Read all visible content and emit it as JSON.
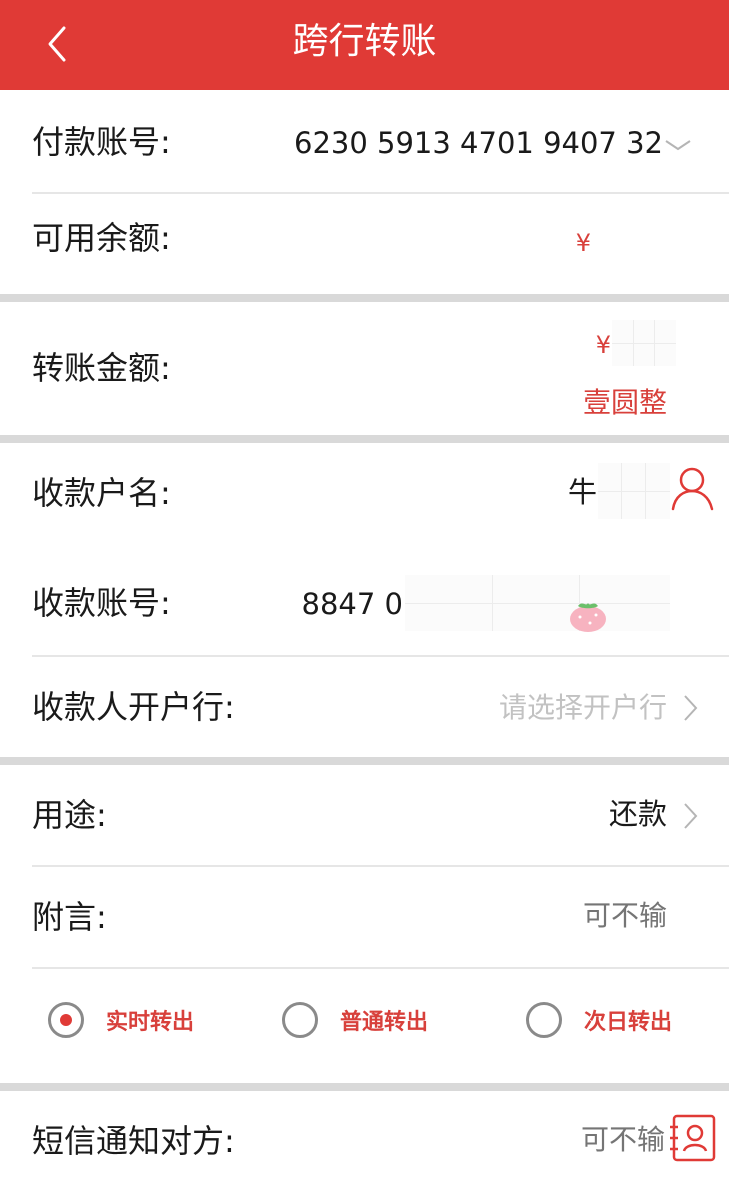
{
  "header": {
    "title": "跨行转账",
    "back_icon": "chevron-left-icon",
    "background": "#e03a36"
  },
  "payer": {
    "account_label": "付款账号:",
    "account_value": "6230 5913 4701 9407 32",
    "balance_label": "可用余额:",
    "balance_prefix": "¥"
  },
  "transfer": {
    "amount_label": "转账金额:",
    "amount_prefix": "¥",
    "amount_words": "壹圆整"
  },
  "payee": {
    "name_label": "收款户名:",
    "name_partial": "牛",
    "account_label": "收款账号:",
    "account_partial": "8847 0",
    "bank_label": "收款人开户行:",
    "bank_placeholder": "请选择开户行"
  },
  "details": {
    "purpose_label": "用途:",
    "purpose_value": "还款",
    "memo_label": "附言:",
    "memo_placeholder": "可不输"
  },
  "transfer_modes": [
    {
      "label": "实时转出",
      "selected": true
    },
    {
      "label": "普通转出",
      "selected": false
    },
    {
      "label": "次日转出",
      "selected": false
    }
  ],
  "sms": {
    "label": "短信通知对方:",
    "placeholder": "可不输"
  },
  "colors": {
    "accent": "#e03a36",
    "accent_text": "#d8403b",
    "separator": "#d9d9d9"
  }
}
